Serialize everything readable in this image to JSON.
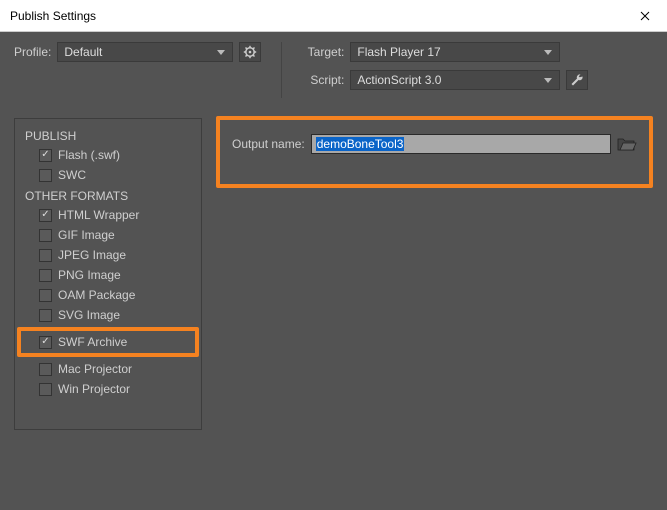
{
  "window": {
    "title": "Publish Settings"
  },
  "topbar": {
    "profile_label": "Profile:",
    "profile_value": "Default",
    "target_label": "Target:",
    "target_value": "Flash Player 17",
    "script_label": "Script:",
    "script_value": "ActionScript 3.0"
  },
  "sidebar": {
    "publish_head": "PUBLISH",
    "other_head": "OTHER FORMATS",
    "items": {
      "flash": {
        "label": "Flash (.swf)",
        "checked": true
      },
      "swc": {
        "label": "SWC",
        "checked": false
      },
      "html": {
        "label": "HTML Wrapper",
        "checked": true
      },
      "gif": {
        "label": "GIF Image",
        "checked": false
      },
      "jpeg": {
        "label": "JPEG Image",
        "checked": false
      },
      "png": {
        "label": "PNG Image",
        "checked": false
      },
      "oam": {
        "label": "OAM Package",
        "checked": false
      },
      "svg": {
        "label": "SVG Image",
        "checked": false
      },
      "swfarc": {
        "label": "SWF Archive",
        "checked": true
      },
      "mac": {
        "label": "Mac Projector",
        "checked": false
      },
      "win": {
        "label": "Win Projector",
        "checked": false
      }
    }
  },
  "output": {
    "label": "Output name:",
    "value": "demoBoneTool3"
  }
}
